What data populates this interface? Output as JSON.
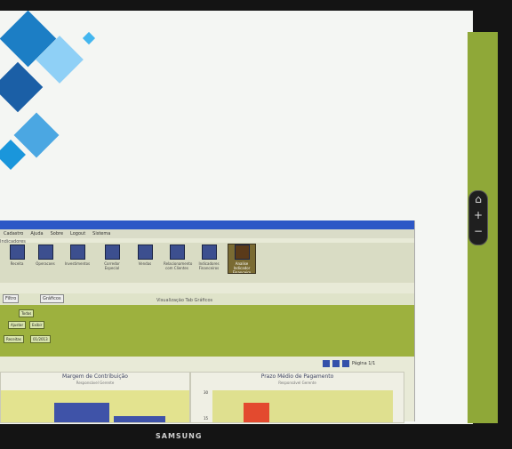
{
  "tv": {
    "brand": "SAMSUNG",
    "remote": {
      "home_icon": "home-icon",
      "zoom_in": "+",
      "zoom_out": "−"
    }
  },
  "menu": [
    "Cadastro",
    "Ajuda",
    "Sobre",
    "Logout",
    "Sistema"
  ],
  "toolbar": {
    "title": "Indicadores",
    "items": [
      "Receita",
      "Operacoes",
      "Investimentos",
      "Corredor Especial",
      "Vendas",
      "Relacionamento com Clientes",
      "Indicadores Financeiros",
      "Analise Indicador Financeiro"
    ]
  },
  "filters": {
    "tabs": [
      "Filtro",
      "Gráficos"
    ],
    "view_label": "Visualização",
    "view_options": [
      "Tab",
      "Gráficos"
    ],
    "fields": [
      "Todas",
      "Ajustar",
      "Exibir",
      "Receitas",
      "01/2013"
    ]
  },
  "pager": {
    "page_label": "Página 1/1"
  },
  "panels": [
    {
      "title": "Margem de Contribuição",
      "subtitle": "Responsável Gerente"
    },
    {
      "title": "Prazo Médio de Pagamento",
      "subtitle": "Responsável Gerente",
      "axis_ticks": [
        "30",
        "15"
      ]
    }
  ],
  "colors": {
    "window_bg": "#e8ead7",
    "panel_bar_blue": "#3f53a8",
    "panel_bar_red": "#e34a2f",
    "chart_bg": "#e3e38f",
    "green_panel": "#9db13e",
    "tv_bezel": "#141414"
  },
  "chart_data": [
    {
      "type": "bar",
      "title": "Margem de Contribuição",
      "categories": [
        "",
        ""
      ],
      "series": [
        {
          "values": [
            18,
            6
          ]
        }
      ]
    },
    {
      "type": "bar",
      "title": "Prazo Médio de Pagamento",
      "categories": [
        ""
      ],
      "series": [
        {
          "values": [
            25
          ]
        }
      ],
      "yticks": [
        "30",
        "15"
      ]
    }
  ]
}
